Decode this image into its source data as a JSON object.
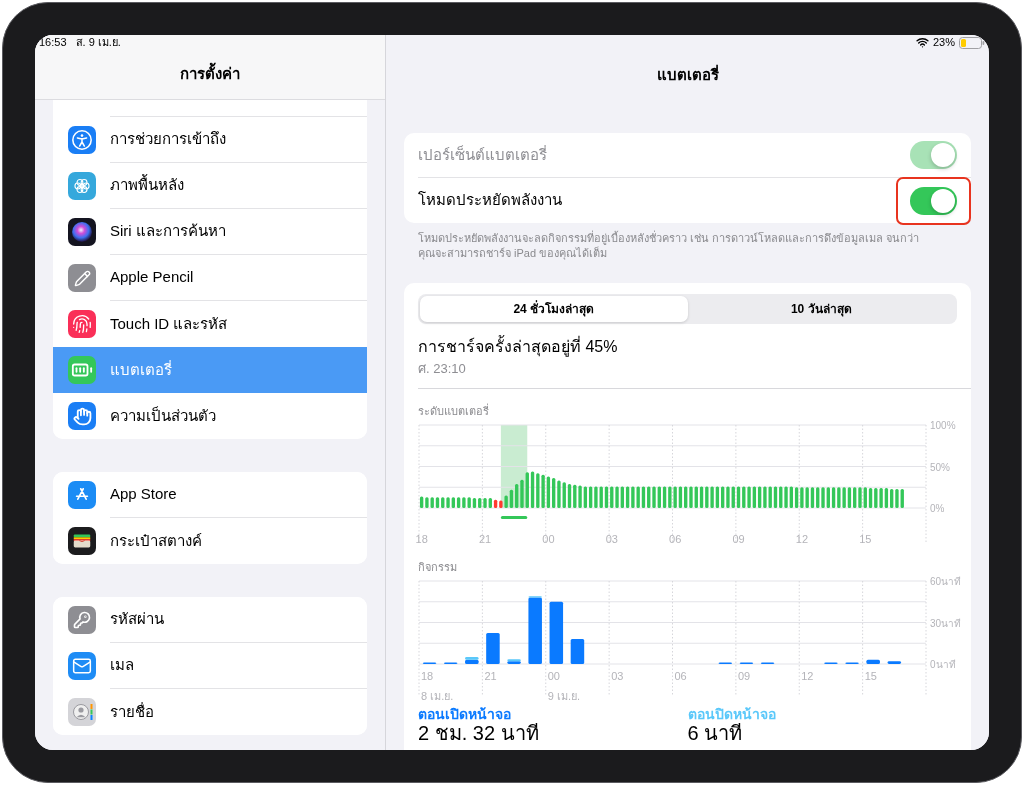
{
  "status_bar": {
    "time": "16:53",
    "date": "ส. 9 เม.ย.",
    "battery": "23%"
  },
  "sidebar": {
    "title": "การตั้งค่า",
    "groups": [
      {
        "items": [
          {
            "kind": "accessibility",
            "label": "การช่วยการเข้าถึง",
            "selected": false
          },
          {
            "kind": "wallpaper",
            "label": "ภาพพื้นหลัง",
            "selected": false
          },
          {
            "kind": "siri",
            "label": "Siri และการค้นหา",
            "selected": false
          },
          {
            "kind": "pencil",
            "label": "Apple Pencil",
            "selected": false
          },
          {
            "kind": "touchid",
            "label": "Touch ID และรหัส",
            "selected": false
          },
          {
            "kind": "battery",
            "label": "แบตเตอรี่",
            "selected": true
          },
          {
            "kind": "privacy",
            "label": "ความเป็นส่วนตัว",
            "selected": false
          }
        ]
      },
      {
        "items": [
          {
            "kind": "appstore",
            "label": "App Store",
            "selected": false
          },
          {
            "kind": "wallet",
            "label": "กระเป๋าสตางค์",
            "selected": false
          }
        ]
      },
      {
        "items": [
          {
            "kind": "passwords",
            "label": "รหัสผ่าน",
            "selected": false
          },
          {
            "kind": "mail",
            "label": "เมล",
            "selected": false
          },
          {
            "kind": "contacts",
            "label": "รายชื่อ",
            "selected": false
          }
        ]
      }
    ]
  },
  "detail": {
    "title": "แบตเตอรี่",
    "toggles": [
      {
        "label": "เปอร์เซ็นต์แบตเตอรี่",
        "on": true,
        "disabled": true,
        "highlighted": false
      },
      {
        "label": "โหมดประหยัดพลังงาน",
        "on": true,
        "disabled": false,
        "highlighted": true
      }
    ],
    "toggles_footer": "โหมดประหยัดพลังงานจะลดกิจกรรมที่อยู่เบื้องหลังชั่วคราว เช่น การดาวน์โหลดและการดึงข้อมูลเมล จนกว่าคุณจะสามารถชาร์จ iPad ของคุณได้เต็ม",
    "segments": [
      {
        "label": "24 ชั่วโมงล่าสุด",
        "selected": true
      },
      {
        "label": "10 วันล่าสุด",
        "selected": false
      }
    ],
    "last_charge": {
      "title": "การชาร์จครั้งล่าสุดอยู่ที่ 45%",
      "time": "ศ. 23:10"
    },
    "battery_chart": {
      "chart_data": {
        "type": "bar",
        "title": "ระดับแบตเตอรี่",
        "categories": [
          "18",
          null,
          null,
          null,
          null,
          null,
          null,
          null,
          null,
          null,
          null,
          null,
          "21",
          null,
          null,
          null,
          null,
          null,
          null,
          null,
          null,
          null,
          null,
          null,
          "00",
          null,
          null,
          null,
          null,
          null,
          null,
          null,
          null,
          null,
          null,
          null,
          "03",
          null,
          null,
          null,
          null,
          null,
          null,
          null,
          null,
          null,
          null,
          null,
          "06",
          null,
          null,
          null,
          null,
          null,
          null,
          null,
          null,
          null,
          null,
          null,
          "09",
          null,
          null,
          null,
          null,
          null,
          null,
          null,
          null,
          null,
          null,
          null,
          "12",
          null,
          null,
          null,
          null,
          null,
          null,
          null,
          null,
          null,
          null,
          null,
          "15",
          null,
          null,
          null,
          null,
          null,
          null,
          null,
          null,
          null,
          null,
          null
        ],
        "ylim": [
          0,
          100
        ],
        "yticks": [
          {
            "value": 100,
            "label": "100%"
          },
          {
            "value": 50,
            "label": "50%"
          },
          {
            "value": 0,
            "label": "0%"
          }
        ],
        "series": [
          {
            "color": "#34c759",
            "values": [
              14,
              13,
              13,
              13,
              13,
              13,
              13,
              13,
              13,
              13,
              12,
              12,
              12,
              12,
              null,
              null,
              15,
              22,
              29,
              34,
              43,
              44,
              42,
              40,
              38,
              36,
              33,
              31,
              29,
              28,
              27,
              26,
              26,
              26,
              26,
              26,
              26,
              26,
              26,
              26,
              26,
              26,
              26,
              26,
              26,
              26,
              26,
              26,
              26,
              26,
              26,
              26,
              26,
              26,
              26,
              26,
              26,
              26,
              26,
              26,
              26,
              26,
              26,
              26,
              26,
              26,
              26,
              26,
              26,
              26,
              26,
              25,
              25,
              25,
              25,
              25,
              25,
              25,
              25,
              25,
              25,
              25,
              25,
              25,
              25,
              24,
              24,
              24,
              24,
              23,
              23,
              23,
              null,
              null,
              null,
              null
            ]
          },
          {
            "color": "#ff3b30",
            "values": [
              null,
              null,
              null,
              null,
              null,
              null,
              null,
              null,
              null,
              null,
              null,
              null,
              null,
              null,
              10,
              9,
              null,
              null,
              null,
              null,
              null,
              null,
              null,
              null,
              null,
              null,
              null,
              null,
              null,
              null,
              null,
              null,
              null,
              null,
              null,
              null,
              null,
              null,
              null,
              null,
              null,
              null,
              null,
              null,
              null,
              null,
              null,
              null,
              null,
              null,
              null,
              null,
              null,
              null,
              null,
              null,
              null,
              null,
              null,
              null,
              null,
              null,
              null,
              null,
              null,
              null,
              null,
              null,
              null,
              null,
              null,
              null,
              null,
              null,
              null,
              null,
              null,
              null,
              null,
              null,
              null,
              null,
              null,
              null,
              null,
              null,
              null,
              null,
              null,
              null,
              null,
              null,
              null,
              null,
              null,
              null
            ]
          }
        ]
      },
      "charging": [
        false,
        false,
        false,
        false,
        false,
        false,
        false,
        false,
        false,
        false,
        false,
        false,
        false,
        false,
        false,
        false,
        true,
        true,
        true,
        true,
        true,
        false,
        false,
        false,
        false,
        false,
        false,
        false,
        false,
        false,
        false,
        false,
        false,
        false,
        false,
        false,
        false,
        false,
        false,
        false,
        false,
        false,
        false,
        false,
        false,
        false,
        false,
        false,
        false,
        false,
        false,
        false,
        false,
        false,
        false,
        false,
        false,
        false,
        false,
        false,
        false,
        false,
        false,
        false,
        false,
        false,
        false,
        false,
        false,
        false,
        false,
        false,
        false,
        false,
        false,
        false,
        false,
        false,
        false,
        false,
        false,
        false,
        false,
        false,
        false,
        false,
        false,
        false,
        false,
        false,
        false,
        false
      ]
    },
    "activity_chart": {
      "chart_data": {
        "type": "bar",
        "title": "กิจกรรม",
        "stacked": true,
        "categories": [
          "18\n8 เม.ย.",
          null,
          null,
          "21",
          null,
          null,
          "00\n9 เม.ย.",
          null,
          null,
          "03",
          null,
          null,
          "06",
          null,
          null,
          "09",
          null,
          null,
          "12",
          null,
          null,
          "15",
          null,
          null
        ],
        "ylim": [
          0,
          60
        ],
        "yticks": [
          {
            "value": 60,
            "label": "60นาที"
          },
          {
            "value": 30,
            "label": "30นาที"
          },
          {
            "value": 0,
            "label": "0นาที"
          }
        ],
        "series": [
          {
            "name": "ตอนเปิดหน้าจอ",
            "color": "#0a7aff",
            "values": [
              1,
              1,
              3,
              22.5,
              2,
              48,
              45,
              18,
              0,
              0,
              0,
              0,
              0,
              0,
              1,
              1,
              1,
              0,
              0,
              1,
              1,
              3,
              2,
              0
            ]
          },
          {
            "name": "ตอนปิดหน้าจอ",
            "color": "#5ac8fa",
            "values": [
              0,
              0,
              2,
              0,
              1.5,
              1,
              0,
              0,
              0,
              0,
              0,
              0,
              0,
              0,
              0,
              0,
              0,
              0,
              0,
              0,
              0,
              0,
              0,
              0
            ]
          }
        ]
      }
    },
    "usage_totals": [
      "2 ชม. 32 นาที",
      "6 นาที"
    ]
  }
}
